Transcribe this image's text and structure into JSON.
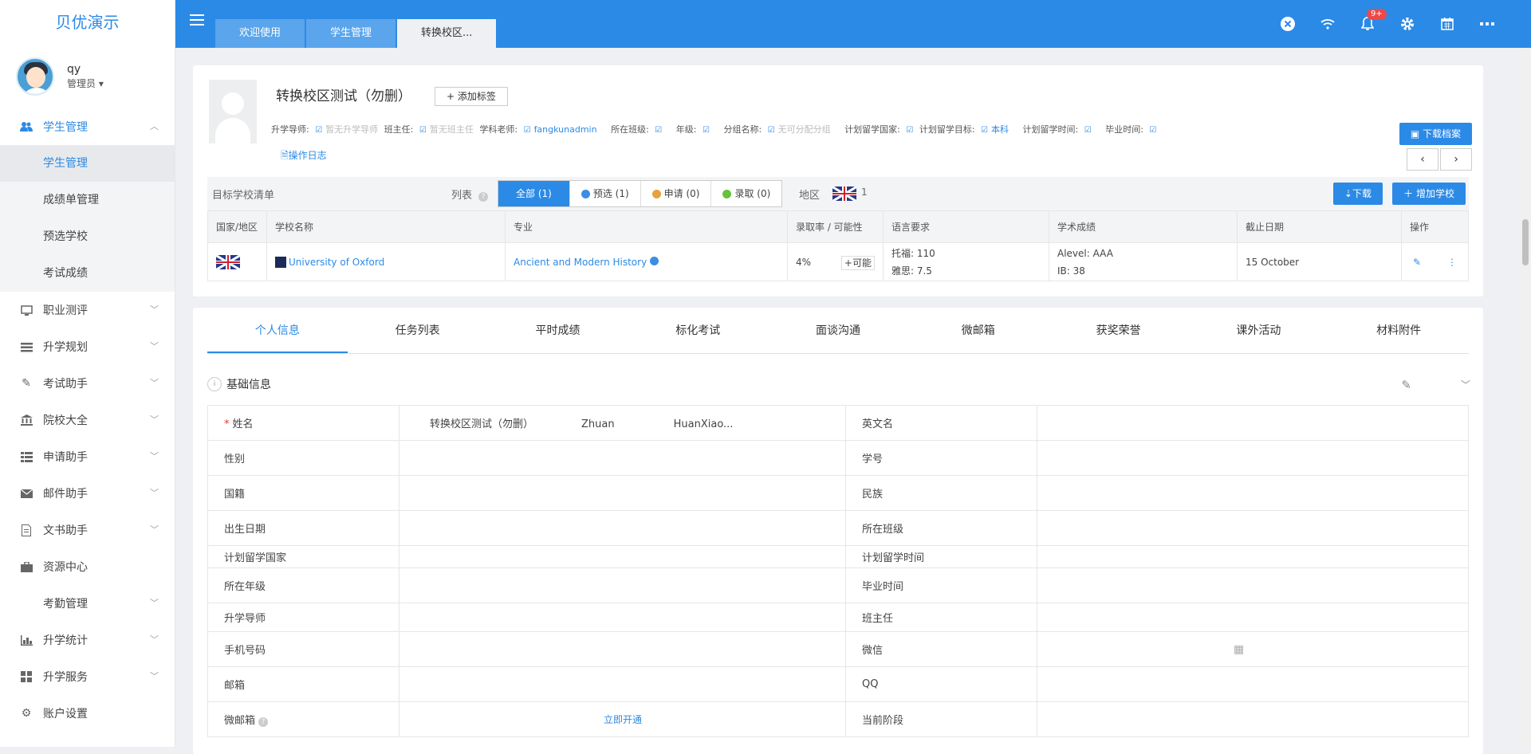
{
  "brand": "贝优演示",
  "user": {
    "name": "qy",
    "role": "管理员"
  },
  "menu": [
    {
      "label": "学生管理",
      "icon": "users-icon"
    },
    {
      "label": "职业测评",
      "icon": "monitor-icon"
    },
    {
      "label": "升学规划",
      "icon": "list-icon"
    },
    {
      "label": "考试助手",
      "icon": "edit-icon"
    },
    {
      "label": "院校大全",
      "icon": "bank-icon"
    },
    {
      "label": "申请助手",
      "icon": "grid-list-icon"
    },
    {
      "label": "邮件助手",
      "icon": "mail-icon"
    },
    {
      "label": "文书助手",
      "icon": "document-icon"
    },
    {
      "label": "资源中心",
      "icon": "briefcase-icon"
    },
    {
      "label": "考勤管理",
      "icon": ""
    },
    {
      "label": "升学统计",
      "icon": "bar-chart-icon"
    },
    {
      "label": "升学服务",
      "icon": "apps-icon"
    },
    {
      "label": "账户设置",
      "icon": "gear-icon"
    }
  ],
  "submenu": [
    "学生管理",
    "成绩单管理",
    "预选学校",
    "考试成绩"
  ],
  "tabs": [
    "欢迎使用",
    "学生管理",
    "转换校区..."
  ],
  "notification_badge": "9+",
  "student": {
    "name": "转换校区测试（勿删）",
    "add_tag": "+ 添加标签",
    "meta": {
      "advisor_label": "升学导师:",
      "advisor": "暂无升学导师",
      "head_label": "班主任:",
      "head": "暂无班主任",
      "subject_label": "学科老师:",
      "subject": "fangkunadmin",
      "class_label": "所在班级:",
      "grade_label": "年级:",
      "group_label": "分组名称:",
      "group": "无可分配分组",
      "country_label": "计划留学国家:",
      "target_label": "计划留学目标:",
      "target": "本科",
      "time_label": "计划留学时间:",
      "grad_label": "毕业时间:"
    },
    "oplog": "操作日志",
    "download_archive": "下载档案"
  },
  "target_schools": {
    "title": "目标学校清单",
    "list_label": "列表",
    "filters": [
      {
        "label": "全部 (1)",
        "dot": ""
      },
      {
        "label": "预选 (1)",
        "dot": "#3a8ee6"
      },
      {
        "label": "申请 (0)",
        "dot": "#e6a23c"
      },
      {
        "label": "录取 (0)",
        "dot": "#67c23a"
      }
    ],
    "region_label": "地区",
    "region_count": "1",
    "download": "下载",
    "add_school": "增加学校",
    "columns": [
      "国家/地区",
      "学校名称",
      "专业",
      "录取率 / 可能性",
      "语言要求",
      "学术成绩",
      "截止日期",
      "操作"
    ],
    "rows": [
      {
        "school": "University of Oxford",
        "major": "Ancient and Modern History",
        "rate": "4%",
        "possibility": "可能",
        "lang1": "托福: 110",
        "lang2": "雅思: 7.5",
        "acad1": "Alevel: AAA",
        "acad2": "IB: 38",
        "deadline": "15 October"
      }
    ]
  },
  "profile_tabs": [
    "个人信息",
    "任务列表",
    "平时成绩",
    "标化考试",
    "面谈沟通",
    "微邮箱",
    "获奖荣誉",
    "课外活动",
    "材料附件"
  ],
  "basic_info": {
    "title": "基础信息",
    "name_cn": "转换校区测试（勿删）",
    "name_pinyin1": "Zhuan",
    "name_pinyin2": "HuanXiao...",
    "open_link": "立即开通",
    "rows": [
      [
        "姓名",
        "英文名"
      ],
      [
        "性别",
        "学号"
      ],
      [
        "国籍",
        "民族"
      ],
      [
        "出生日期",
        "所在班级"
      ],
      [
        "计划留学国家",
        "计划留学时间"
      ],
      [
        "所在年级",
        "毕业时间"
      ],
      [
        "升学导师",
        "班主任"
      ],
      [
        "手机号码",
        "微信"
      ],
      [
        "邮箱",
        "QQ"
      ],
      [
        "微邮箱",
        "当前阶段"
      ]
    ]
  }
}
